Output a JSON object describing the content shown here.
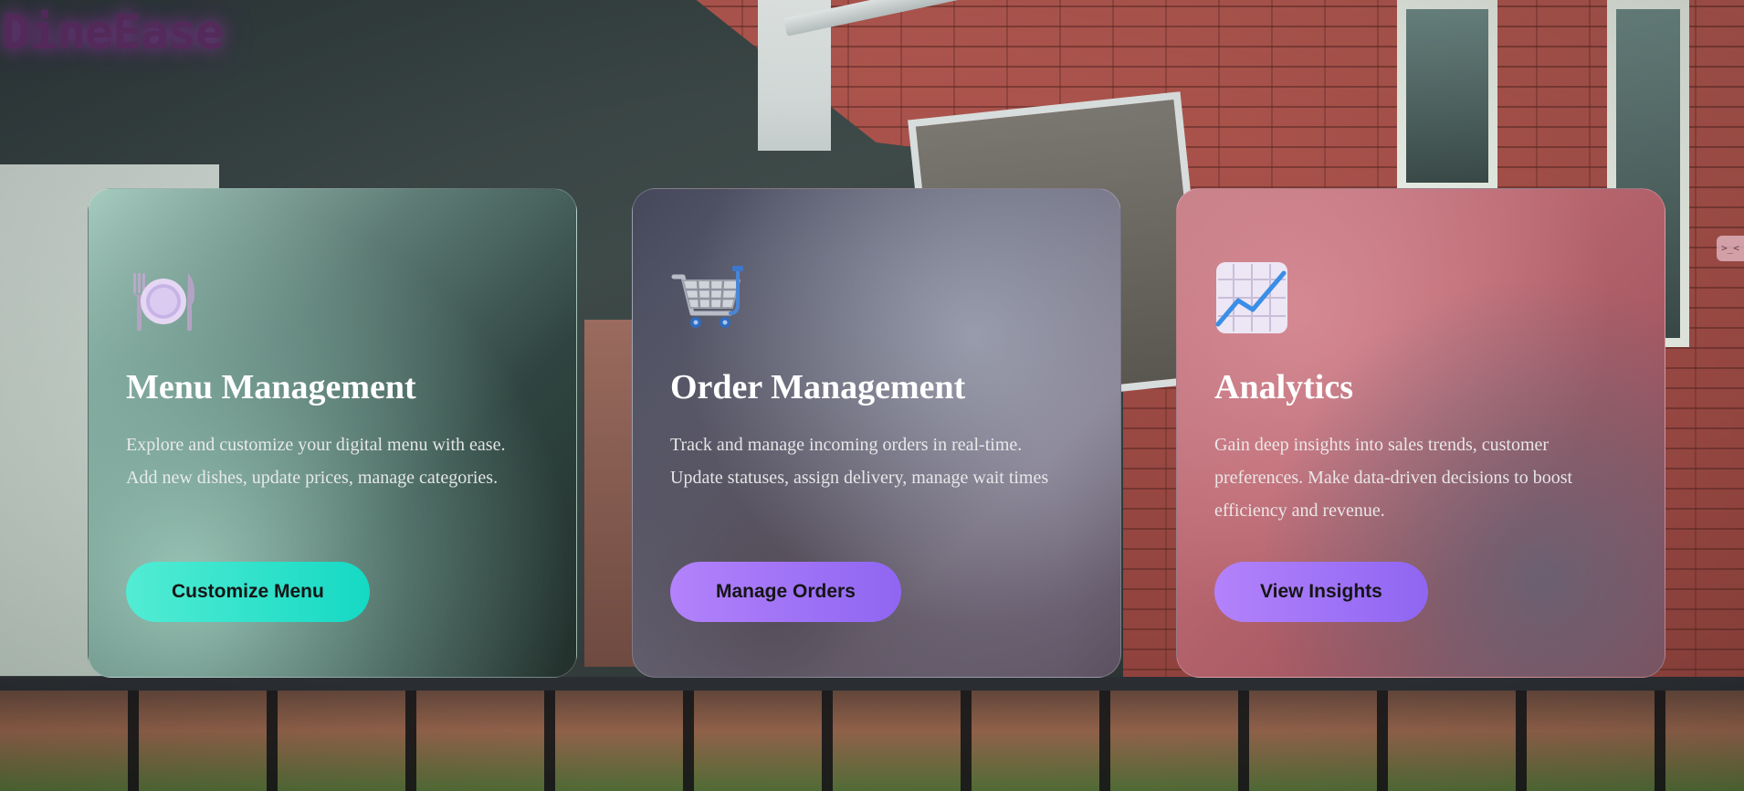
{
  "brand": {
    "logo_text": "DineEase",
    "glow_color": "#9b2fb0"
  },
  "edge_tab": {
    "label": ">_<"
  },
  "cards": [
    {
      "icon": "plate-fork-knife-icon",
      "title": "Menu Management",
      "description": "Explore and customize your digital menu with ease. Add new dishes, update prices, manage categories.",
      "button_label": "Customize Menu",
      "button_color": "#2de3cc"
    },
    {
      "icon": "shopping-cart-icon",
      "title": "Order Management",
      "description": "Track and manage incoming orders in real-time. Update statuses, assign delivery, manage wait times",
      "button_label": "Manage Orders",
      "button_color": "#a174f7"
    },
    {
      "icon": "chart-increasing-icon",
      "title": "Analytics",
      "description": "Gain deep insights into sales trends, customer preferences. Make data-driven decisions to boost efficiency and revenue.",
      "button_label": "View Insights",
      "button_color": "#a174f7"
    }
  ]
}
